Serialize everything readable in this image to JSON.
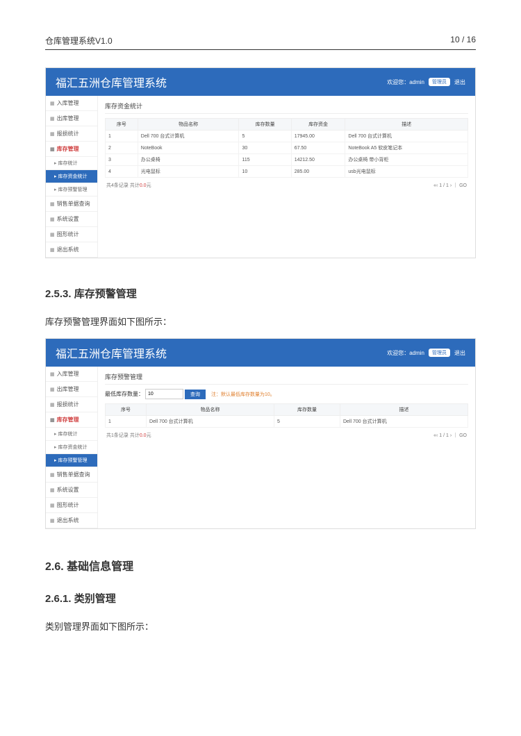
{
  "page_header": {
    "left": "仓库管理系统V1.0",
    "right": "10 / 16"
  },
  "app_common": {
    "title": "福汇五洲仓库管理系统",
    "welcome": "欢迎您：admin",
    "role": "管理员",
    "logout": "退出"
  },
  "sidebar": {
    "items": [
      {
        "label": "入库管理"
      },
      {
        "label": "出库管理"
      },
      {
        "label": "报损统计"
      },
      {
        "label": "库存管理",
        "active": true
      },
      {
        "label": "销售单据查询"
      },
      {
        "label": "系统设置"
      },
      {
        "label": "图形统计"
      },
      {
        "label": "退出系统"
      }
    ],
    "subA": [
      {
        "label": "库存统计"
      },
      {
        "label": "库存资金统计",
        "sel": true
      },
      {
        "label": "库存预警管理"
      }
    ],
    "subB": [
      {
        "label": "库存统计"
      },
      {
        "label": "库存资金统计"
      },
      {
        "label": "库存预警管理",
        "sel": true
      }
    ]
  },
  "screenA": {
    "panel_title": "库存资金统计",
    "headers": [
      "序号",
      "物品名称",
      "库存数量",
      "库存资金",
      "描述"
    ],
    "rows": [
      [
        "1",
        "Dell 700 台式计算机",
        "5",
        "17945.00",
        "Dell 700 台式计算机"
      ],
      [
        "2",
        "NoteBook",
        "30",
        "67.50",
        "NoteBook A5 软皮笔记本"
      ],
      [
        "3",
        "办公桌椅",
        "115",
        "14212.50",
        "办公桌椅 带小背柜"
      ],
      [
        "4",
        "光电鼠标",
        "10",
        "285.00",
        "usb光电鼠标"
      ]
    ],
    "page_left_a": "共4条记录 共计",
    "page_left_b": "0.0",
    "page_left_c": "元",
    "page_right": "«‹ 1 / 1 ›  ｜  GO"
  },
  "screenB": {
    "panel_title": "库存预警管理",
    "filter_label": "最低库存数量：",
    "filter_value": "10",
    "btn": "查询",
    "note": "注：默认最低库存数量为10。",
    "headers": [
      "序号",
      "物品名称",
      "库存数量",
      "描述"
    ],
    "rows": [
      [
        "1",
        "Dell 700 台式计算机",
        "5",
        "Dell 700 台式计算机"
      ]
    ],
    "page_left_a": "共1条记录 共计",
    "page_left_b": "0.0",
    "page_left_c": "元",
    "page_right": "«‹ 1 / 1 ›  ｜  GO"
  },
  "sections": {
    "s253_title": "2.5.3. 库存预警管理",
    "s253_para": "库存预警管理界面如下图所示：",
    "s26_title": "2.6. 基础信息管理",
    "s261_title": "2.6.1. 类别管理",
    "s261_para": "类别管理界面如下图所示："
  }
}
